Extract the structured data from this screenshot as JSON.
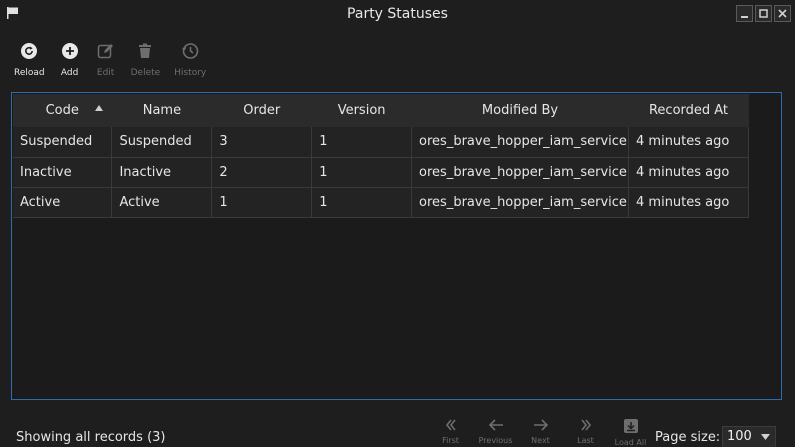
{
  "window": {
    "title": "Party Statuses"
  },
  "toolbar": {
    "reload": "Reload",
    "add": "Add",
    "edit": "Edit",
    "delete": "Delete",
    "history": "History"
  },
  "table": {
    "columns": [
      "Code",
      "Name",
      "Order",
      "Version",
      "Modified By",
      "Recorded At"
    ],
    "sort_column": "Code",
    "rows": [
      [
        "Suspended",
        "Suspended",
        "3",
        "1",
        "ores_brave_hopper_iam_service",
        "4 minutes ago"
      ],
      [
        "Inactive",
        "Inactive",
        "2",
        "1",
        "ores_brave_hopper_iam_service",
        "4 minutes ago"
      ],
      [
        "Active",
        "Active",
        "1",
        "1",
        "ores_brave_hopper_iam_service",
        "4 minutes ago"
      ]
    ]
  },
  "footer": {
    "status": "Showing all records (3)",
    "pager": {
      "first": "First",
      "previous": "Previous",
      "next": "Next",
      "last": "Last",
      "load_all": "Load All"
    },
    "page_size_label": "Page size:",
    "page_size": "100"
  },
  "colors": {
    "accent_border": "#2d6cb0",
    "background": "#1e1e1e"
  }
}
